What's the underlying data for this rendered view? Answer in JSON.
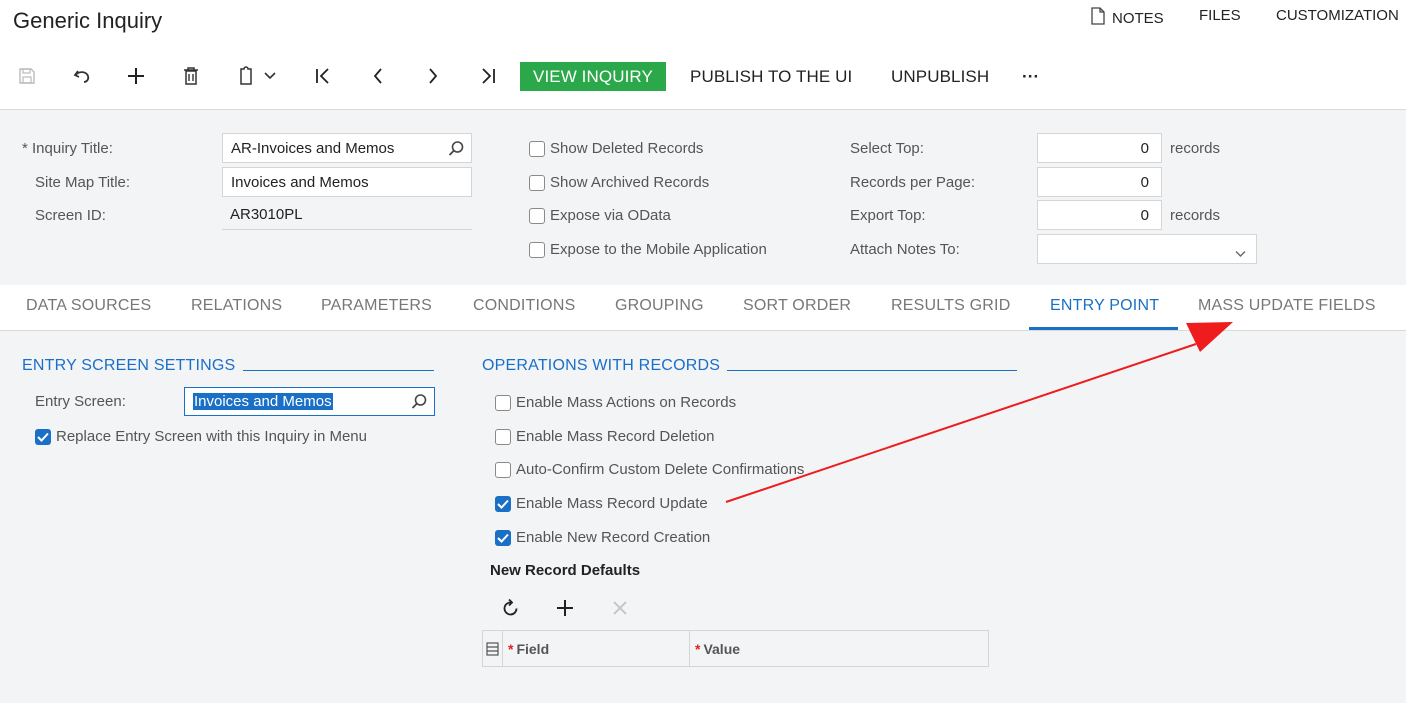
{
  "header": {
    "title": "Generic Inquiry",
    "links": {
      "notes": "NOTES",
      "files": "FILES",
      "customization": "CUSTOMIZATION"
    }
  },
  "toolbar": {
    "icons": [
      "save-icon",
      "undo-icon",
      "add-icon",
      "delete-icon",
      "copy-paste-icon",
      "chevron-down-icon",
      "first-record-icon",
      "previous-record-icon",
      "next-record-icon",
      "last-record-icon"
    ],
    "view_inquiry": "VIEW INQUIRY",
    "publish": "PUBLISH TO THE UI",
    "unpublish": "UNPUBLISH",
    "more": "···",
    "accent_color": "#2ba94a"
  },
  "form": {
    "inquiry_title_label": "Inquiry Title:",
    "inquiry_title_required": "*",
    "inquiry_title_value": "AR-Invoices and Memos",
    "site_map_title_label": "Site Map Title:",
    "site_map_title_value": "Invoices and Memos",
    "screen_id_label": "Screen ID:",
    "screen_id_value": "AR3010PL",
    "show_deleted": {
      "label": "Show Deleted Records",
      "checked": false
    },
    "show_archived": {
      "label": "Show Archived Records",
      "checked": false
    },
    "expose_odata": {
      "label": "Expose via OData",
      "checked": false
    },
    "expose_mobile": {
      "label": "Expose to the Mobile Application",
      "checked": false
    },
    "select_top_label": "Select Top:",
    "select_top_value": "0",
    "select_top_unit": "records",
    "records_per_page_label": "Records per Page:",
    "records_per_page_value": "0",
    "export_top_label": "Export Top:",
    "export_top_value": "0",
    "export_top_unit": "records",
    "attach_notes_label": "Attach Notes To:",
    "attach_notes_value": ""
  },
  "tabs": [
    {
      "label": "DATA SOURCES",
      "active": false
    },
    {
      "label": "RELATIONS",
      "active": false
    },
    {
      "label": "PARAMETERS",
      "active": false
    },
    {
      "label": "CONDITIONS",
      "active": false
    },
    {
      "label": "GROUPING",
      "active": false
    },
    {
      "label": "SORT ORDER",
      "active": false
    },
    {
      "label": "RESULTS GRID",
      "active": false
    },
    {
      "label": "ENTRY POINT",
      "active": true
    },
    {
      "label": "MASS UPDATE FIELDS",
      "active": false
    }
  ],
  "entry_screen_settings": {
    "title": "ENTRY SCREEN SETTINGS",
    "entry_screen_label": "Entry Screen:",
    "entry_screen_value": "Invoices and Memos",
    "replace_entry": {
      "label": "Replace Entry Screen with this Inquiry in Menu",
      "checked": true
    }
  },
  "operations": {
    "title": "OPERATIONS WITH RECORDS",
    "mass_actions": {
      "label": "Enable Mass Actions on Records",
      "checked": false
    },
    "mass_deletion": {
      "label": "Enable Mass Record Deletion",
      "checked": false
    },
    "auto_confirm": {
      "label": "Auto-Confirm Custom Delete Confirmations",
      "checked": false
    },
    "mass_update": {
      "label": "Enable Mass Record Update",
      "checked": true
    },
    "new_record": {
      "label": "Enable New Record Creation",
      "checked": true
    }
  },
  "new_record_defaults": {
    "title": "New Record Defaults",
    "grid_icons": [
      "refresh-icon",
      "add-row-icon",
      "delete-row-icon"
    ],
    "columns": [
      {
        "label": "Field",
        "required": "*"
      },
      {
        "label": "Value",
        "required": "*"
      }
    ]
  },
  "annotation": {
    "color": "#ee1c1c"
  },
  "colors": {
    "accent_blue": "#1a6fc7",
    "checkbox_blue": "#1a6fc7",
    "page_bg": "#f3f4f6"
  }
}
